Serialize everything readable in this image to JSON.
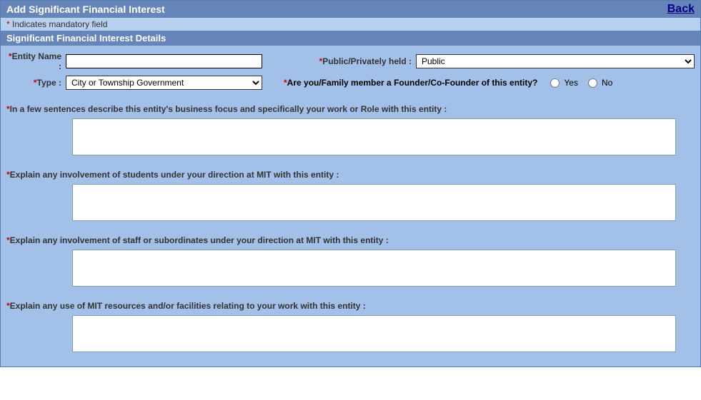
{
  "header": {
    "title": "Add Significant Financial Interest",
    "back": "Back"
  },
  "mandatoryNote": "Indicates mandatory field",
  "sectionHeader": "Significant Financial Interest Details",
  "fields": {
    "entityName": {
      "label": "Entity Name :",
      "value": ""
    },
    "publicPrivate": {
      "label": "Public/Privately held :",
      "value": "Public",
      "options": [
        "Public"
      ]
    },
    "type": {
      "label": "Type :",
      "value": "City or Township Government",
      "options": [
        "City or Township Government"
      ]
    },
    "founder": {
      "label": "Are you/Family member a Founder/Co-Founder of this entity?",
      "yes": "Yes",
      "no": "No"
    }
  },
  "questions": {
    "q1": {
      "label": "In a few sentences describe this entity's business focus and specifically your work or Role with this entity :"
    },
    "q2": {
      "label": "Explain any involvement of students under your direction at MIT with this entity :"
    },
    "q3": {
      "label": "Explain any involvement of staff or subordinates under your direction at MIT with this entity :"
    },
    "q4": {
      "label": "Explain any use of MIT resources and/or facilities relating to your work with this entity :"
    }
  }
}
